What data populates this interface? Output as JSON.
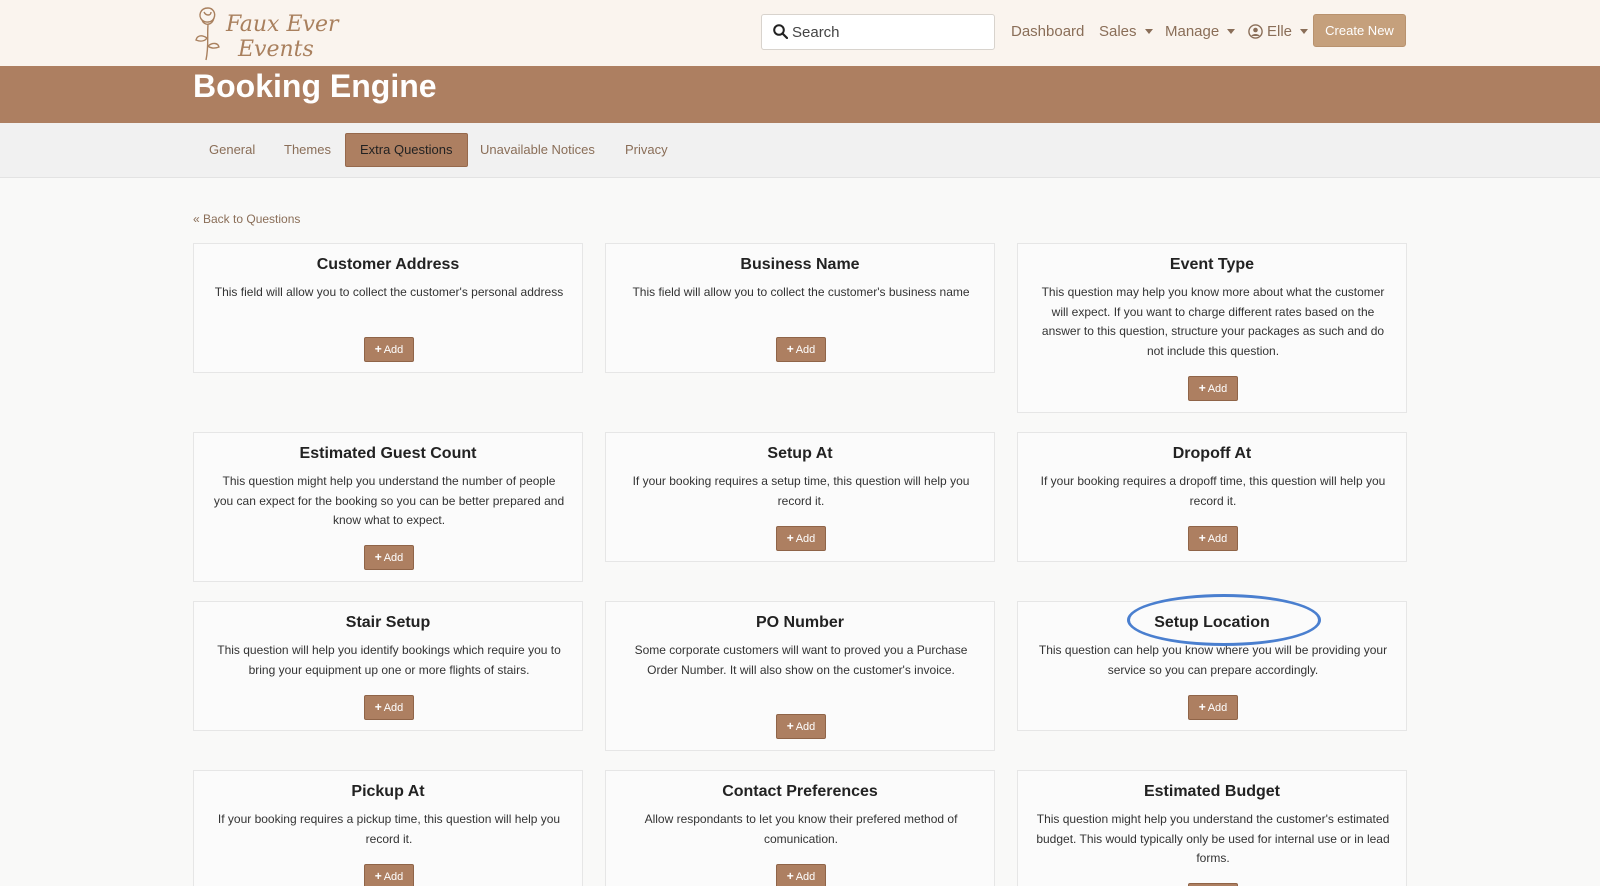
{
  "brand": {
    "line1": "Faux Ever",
    "line2": "Events"
  },
  "search": {
    "placeholder": "Search"
  },
  "nav": {
    "dashboard": "Dashboard",
    "sales": "Sales",
    "manage": "Manage",
    "user": "Elle",
    "create_new": "Create New"
  },
  "page": {
    "title": "Booking Engine"
  },
  "tabs": [
    {
      "label": "General"
    },
    {
      "label": "Themes"
    },
    {
      "label": "Extra Questions"
    },
    {
      "label": "Unavailable Notices"
    },
    {
      "label": "Privacy"
    }
  ],
  "active_tab": "Extra Questions",
  "back_link": "« Back to Questions",
  "add_label": "Add",
  "questions": [
    {
      "title": "Customer Address",
      "desc": "This field will allow you to collect the customer's personal address"
    },
    {
      "title": "Business Name",
      "desc": "This field will allow you to collect the customer's business name"
    },
    {
      "title": "Event Type",
      "desc": "This question may help you know more about what the customer will expect. If you want to charge different rates based on the answer to this question, structure your packages as such and do not include this question."
    },
    {
      "title": "Estimated Guest Count",
      "desc": "This question might help you understand the number of people you can expect for the booking so you can be better prepared and know what to expect."
    },
    {
      "title": "Setup At",
      "desc": "If your booking requires a setup time, this question will help you record it."
    },
    {
      "title": "Dropoff At",
      "desc": "If your booking requires a dropoff time, this question will help you record it."
    },
    {
      "title": "Stair Setup",
      "desc": "This question will help you identify bookings which require you to bring your equipment up one or more flights of stairs."
    },
    {
      "title": "PO Number",
      "desc": "Some corporate customers will want to proved you a Purchase Order Number. It will also show on the customer's invoice."
    },
    {
      "title": "Setup Location",
      "desc": "This question can help you know where you will be providing your service so you can prepare accordingly."
    },
    {
      "title": "Pickup At",
      "desc": "If your booking requires a pickup time, this question will help you record it."
    },
    {
      "title": "Contact Preferences",
      "desc": "Allow respondants to let you know their prefered method of comunication."
    },
    {
      "title": "Estimated Budget",
      "desc": "This question might help you understand the customer's estimated budget. This would typically only be used for internal use or in lead forms."
    }
  ],
  "colors": {
    "brand_brown": "#ad7f61",
    "link_brown": "#8a6e58",
    "create_button": "#c5a07c",
    "highlight_circle": "#4a7fcf"
  }
}
